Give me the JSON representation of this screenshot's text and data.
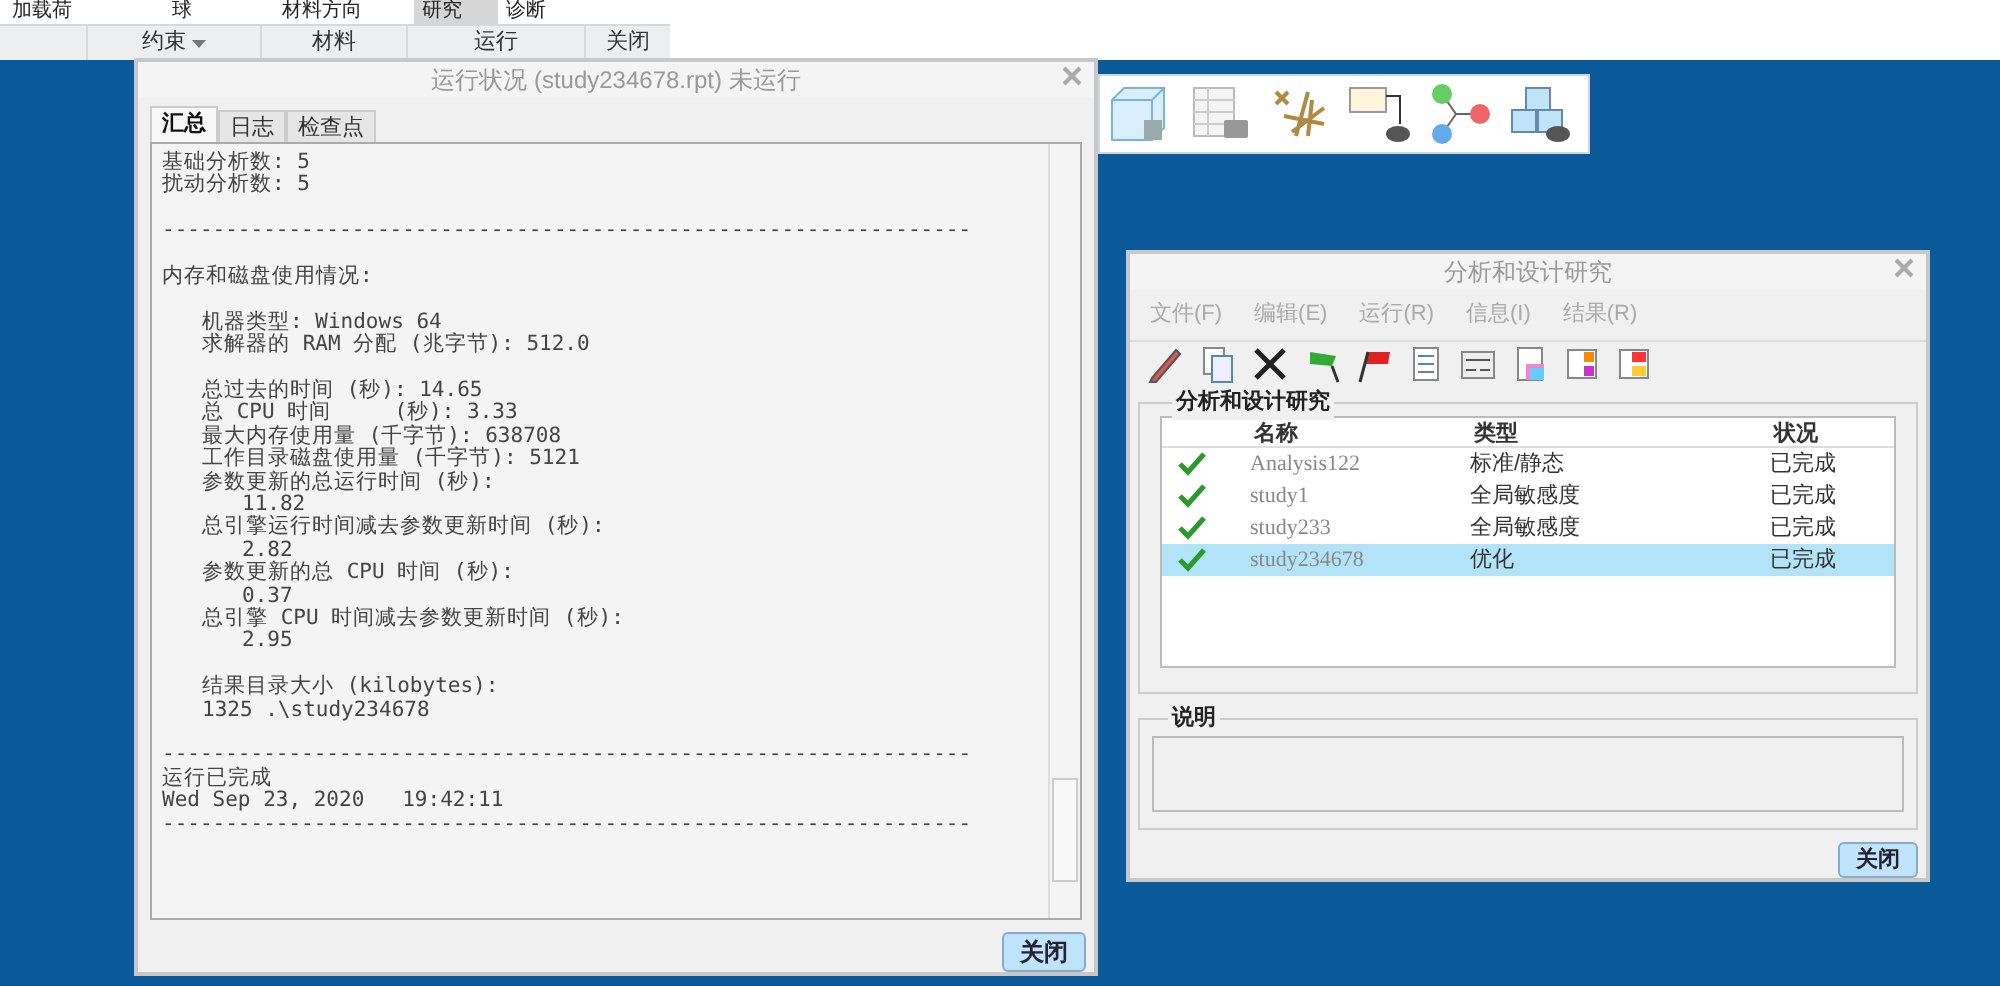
{
  "ribbon": {
    "buttons": [
      {
        "label": "加载荷",
        "selected": false
      },
      {
        "label": "球",
        "selected": false
      },
      {
        "label": "材料方向",
        "selected": false
      },
      {
        "label": "研究",
        "selected": true
      },
      {
        "label": "诊断",
        "selected": false
      }
    ],
    "groups": [
      {
        "label": "约束",
        "dropdown": true
      },
      {
        "label": "材料",
        "dropdown": false
      },
      {
        "label": "运行",
        "dropdown": false
      },
      {
        "label": "关闭",
        "dropdown": false
      }
    ]
  },
  "status_window": {
    "title": "运行状况 (study234678.rpt) 未运行",
    "tabs": [
      {
        "label": "汇总",
        "selected": true
      },
      {
        "label": "日志",
        "selected": false
      },
      {
        "label": "检查点",
        "selected": false
      }
    ],
    "paragraphs": [
      {
        "lines": [
          {
            "text": "基础分析数: 5",
            "kind": "line"
          },
          {
            "text": "扰动分析数: 5",
            "kind": "line"
          }
        ]
      },
      {
        "lines": [
          {
            "text": "----------------------------------------------------------------",
            "kind": "line"
          }
        ]
      },
      {
        "lines": [
          {
            "text": "内存和磁盘使用情况:",
            "kind": "line"
          }
        ]
      },
      {
        "lines": [
          {
            "text": "机器类型: Windows 64",
            "kind": "item"
          },
          {
            "text": "求解器的 RAM 分配 (兆字节): 512.0",
            "kind": "item"
          }
        ]
      },
      {
        "lines": [
          {
            "text": "总过去的时间 (秒): 14.65",
            "kind": "item"
          },
          {
            "text": "总 CPU 时间     (秒): 3.33",
            "kind": "item"
          },
          {
            "text": "最大内存使用量 (千字节): 638708",
            "kind": "item"
          },
          {
            "text": "工作目录磁盘使用量 (千字节): 5121",
            "kind": "item"
          },
          {
            "text": "参数更新的总运行时间 (秒):",
            "kind": "item"
          },
          {
            "text": "11.82",
            "kind": "value"
          },
          {
            "text": "总引擎运行时间减去参数更新时间 (秒):",
            "kind": "item"
          },
          {
            "text": "2.82",
            "kind": "value"
          },
          {
            "text": "参数更新的总 CPU 时间 (秒):",
            "kind": "item"
          },
          {
            "text": "0.37",
            "kind": "value"
          },
          {
            "text": "总引擎 CPU 时间减去参数更新时间 (秒):",
            "kind": "item"
          },
          {
            "text": "2.95",
            "kind": "value"
          }
        ]
      },
      {
        "lines": [
          {
            "text": "结果目录大小 (kilobytes):",
            "kind": "item"
          },
          {
            "text": "1325 .\\study234678",
            "kind": "item"
          }
        ]
      },
      {
        "lines": [
          {
            "text": "----------------------------------------------------------------",
            "kind": "line"
          },
          {
            "text": "运行已完成",
            "kind": "line"
          },
          {
            "text": "Wed Sep 23, 2020   19:42:11",
            "kind": "line"
          },
          {
            "text": "----------------------------------------------------------------",
            "kind": "line"
          }
        ]
      }
    ],
    "close_button": "关闭"
  },
  "study_window": {
    "title": "分析和设计研究",
    "menu": [
      {
        "label": "文件(F)",
        "disabled": true
      },
      {
        "label": "编辑(E)",
        "disabled": true
      },
      {
        "label": "运行(R)",
        "disabled": true
      },
      {
        "label": "信息(I)",
        "disabled": true
      },
      {
        "label": "结果(R)",
        "disabled": true
      }
    ],
    "group_title": "分析和设计研究",
    "columns": [
      "名称",
      "类型",
      "状况"
    ],
    "rows": [
      {
        "name": "Analysis122",
        "type": "标准/静态",
        "status": "已完成",
        "done": true,
        "selected": false
      },
      {
        "name": "study1",
        "type": "全局敏感度",
        "status": "已完成",
        "done": true,
        "selected": false
      },
      {
        "name": "study233",
        "type": "全局敏感度",
        "status": "已完成",
        "done": true,
        "selected": false
      },
      {
        "name": "study234678",
        "type": "优化",
        "status": "已完成",
        "done": true,
        "selected": true
      }
    ],
    "description_title": "说明",
    "close_button": "关闭"
  }
}
